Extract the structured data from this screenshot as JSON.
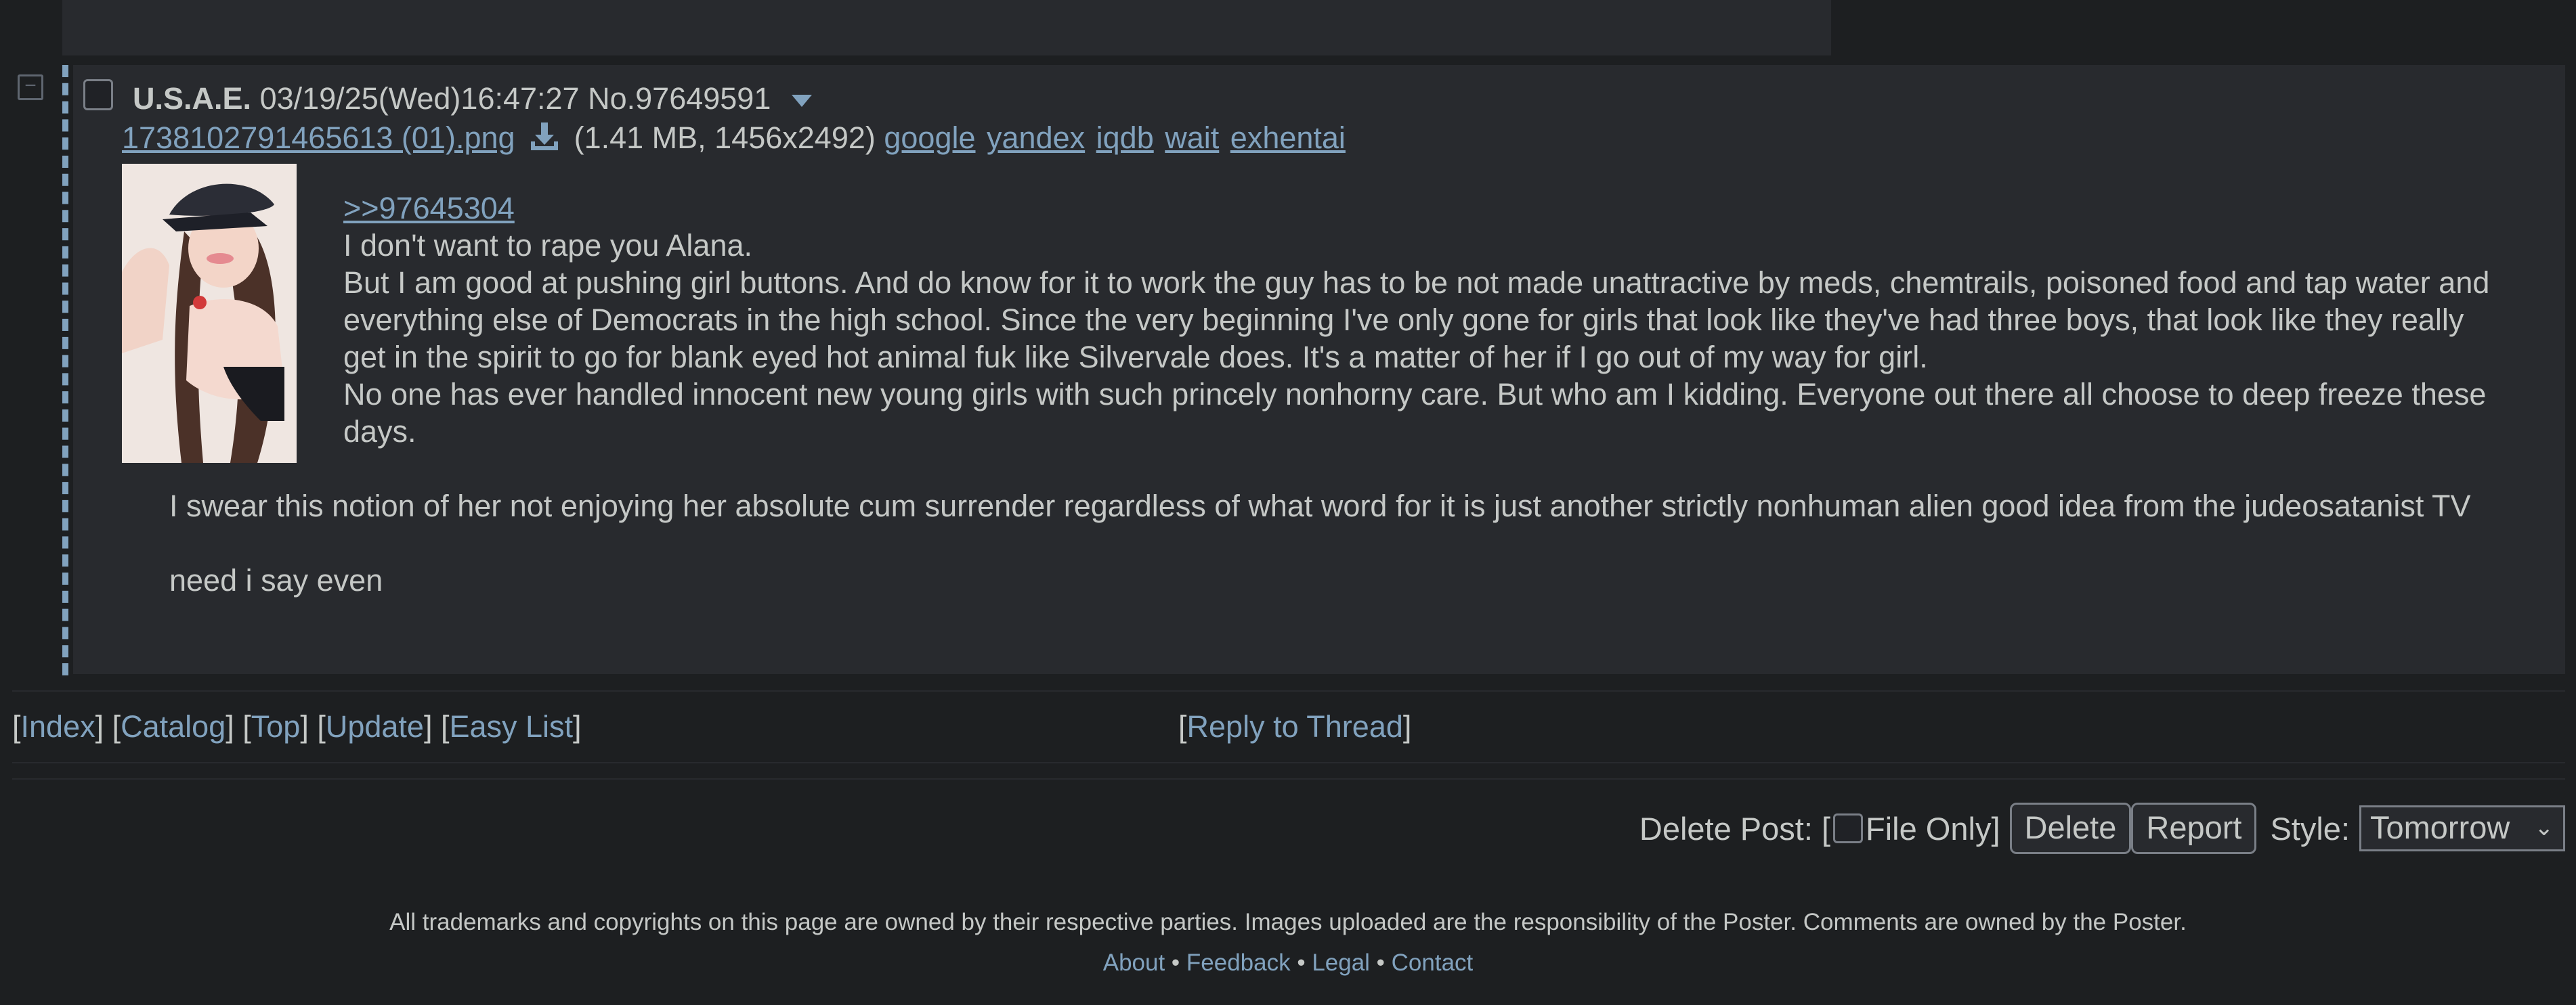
{
  "post": {
    "name": "U.S.A.E.",
    "datetime": "03/19/25(Wed)16:47:27",
    "number": "No.97649591",
    "file": {
      "filename": "1738102791465613 (01).png",
      "meta": "(1.41 MB, 1456x2492)",
      "search_links": [
        "google",
        "yandex",
        "iqdb",
        "wait",
        "exhentai"
      ]
    },
    "quote_link": ">>97645304",
    "body": [
      "I don't want to rape you Alana.",
      "But I am good at pushing girl buttons. And do know for it to work the guy has to be not made unattractive by meds, chemtrails, poisoned food and tap water and everything else of Democrats in the high school. Since the very beginning I've only gone for girls that look like they've had three boys, that look like they really get in the spirit to go for blank eyed hot animal fuk like Silvervale does. It's a matter of her if I go out of my way for girl.",
      "No one has ever handled innocent new young girls with such princely nonhorny care. But who am I kidding. Everyone out there all choose to deep freeze these days."
    ],
    "tail": [
      "I swear this notion of her not enjoying her absolute cum surrender regardless of what word for it is just another strictly nonhuman alien good idea from the judeosatanist TV",
      "need i say even"
    ]
  },
  "nav": {
    "index": "Index",
    "catalog": "Catalog",
    "top": "Top",
    "update": "Update",
    "easy_list": "Easy List",
    "reply": "Reply to Thread"
  },
  "delete_form": {
    "label": "Delete Post: [",
    "file_only": "File Only]",
    "delete_button": "Delete",
    "report_button": "Report",
    "style_label": "Style:",
    "style_value": "Tomorrow"
  },
  "footer": {
    "notice": "All trademarks and copyrights on this page are owned by their respective parties. Images uploaded are the responsibility of the Poster. Comments are owned by the Poster.",
    "links": [
      "About",
      "Feedback",
      "Legal",
      "Contact"
    ]
  }
}
